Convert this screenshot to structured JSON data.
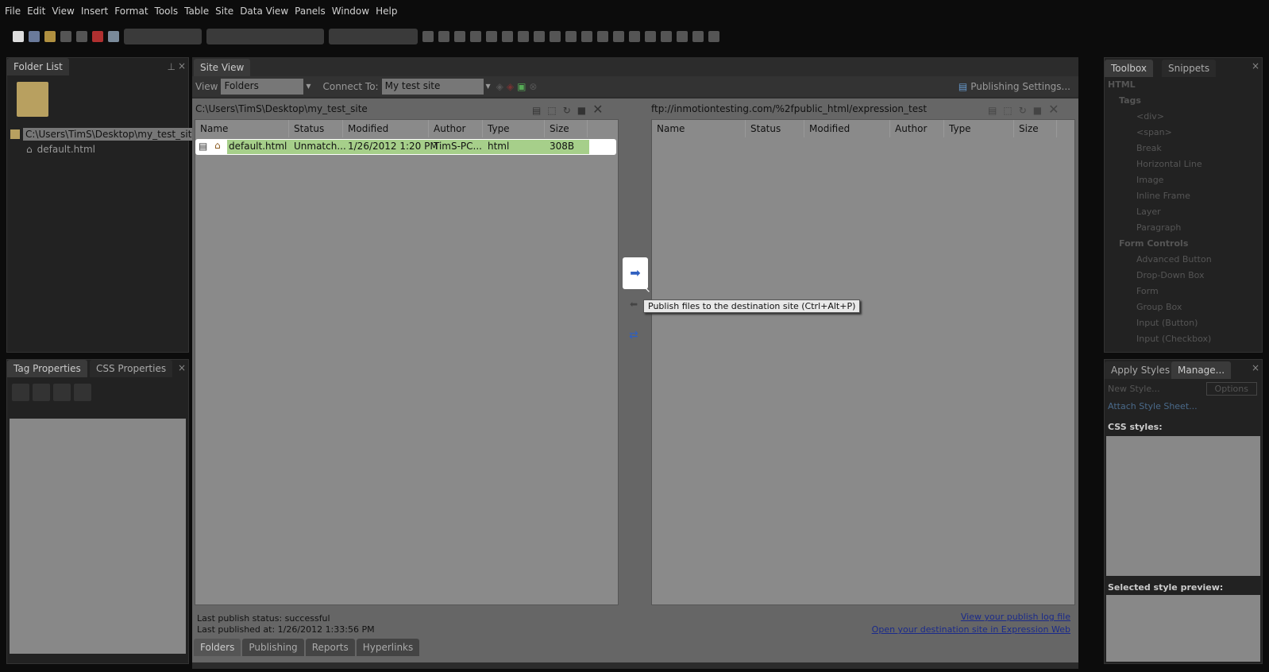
{
  "menu": [
    "File",
    "Edit",
    "View",
    "Insert",
    "Format",
    "Tools",
    "Table",
    "Site",
    "Data View",
    "Panels",
    "Window",
    "Help"
  ],
  "folder_list": {
    "title": "Folder List",
    "root": "C:\\Users\\TimS\\Desktop\\my_test_site",
    "file": "default.html"
  },
  "tag_panel": {
    "tab1": "Tag Properties",
    "tab2": "CSS Properties"
  },
  "site_view": {
    "tab": "Site View",
    "view_label": "View",
    "view_value": "Folders",
    "connect_label": "Connect To:",
    "connect_value": "My test site",
    "publishing_settings": "Publishing Settings...",
    "local_path": "C:\\Users\\TimS\\Desktop\\my_test_site",
    "remote_path": "ftp://inmotiontesting.com/%2fpublic_html/expression_test",
    "columns": [
      "Name",
      "Status",
      "Modified",
      "Author",
      "Type",
      "Size"
    ],
    "rows": [
      {
        "name": "default.html",
        "status": "Unmatch...",
        "modified": "1/26/2012 1:20 PM",
        "author": "TimS-PC...",
        "type": "html",
        "size": "308B"
      }
    ],
    "tooltip": "Publish files to the destination site (Ctrl+Alt+P)",
    "status1": "Last publish status: successful",
    "status2": "Last published at: 1/26/2012 1:33:56 PM",
    "link1": "View your publish log file",
    "link2": "Open your destination site in Expression Web",
    "bottom_tabs": [
      "Folders",
      "Publishing",
      "Reports",
      "Hyperlinks"
    ]
  },
  "toolbox": {
    "tab1": "Toolbox",
    "tab2": "Snippets",
    "html": "HTML",
    "tags": "Tags",
    "tag_items": [
      "<div>",
      "<span>",
      "Break",
      "Horizontal Line",
      "Image",
      "Inline Frame",
      "Layer",
      "Paragraph"
    ],
    "form": "Form Controls",
    "form_items": [
      "Advanced Button",
      "Drop-Down Box",
      "Form",
      "Group Box",
      "Input (Button)",
      "Input (Checkbox)"
    ]
  },
  "styles": {
    "tab1": "Apply Styles",
    "tab2": "Manage...",
    "new_style": "New Style...",
    "options": "Options",
    "attach": "Attach Style Sheet...",
    "css_styles": "CSS styles:",
    "preview": "Selected style preview:"
  }
}
